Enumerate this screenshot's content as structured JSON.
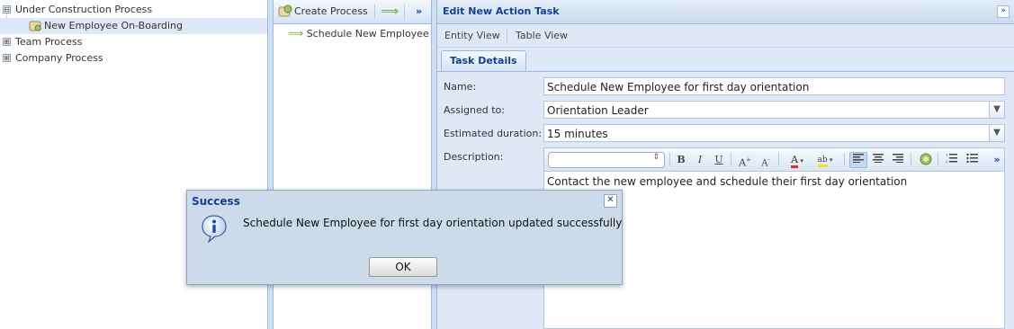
{
  "tree": {
    "items": [
      {
        "label": "Under Construction Process",
        "expander": "⊟"
      },
      {
        "label": "New Employee On-Boarding"
      },
      {
        "label": "Team Process",
        "expander": "⊞"
      },
      {
        "label": "Company Process",
        "expander": "⊞"
      }
    ]
  },
  "middle": {
    "create_label": "Create Process",
    "arrow_glyph": "⟹",
    "more_glyph": "»",
    "item_label": "Schedule New Employee fo"
  },
  "right": {
    "title": "Edit New Action Task",
    "collapse_glyph": "»",
    "views": [
      "Entity View",
      "Table View"
    ],
    "tab_label": "Task Details",
    "form": {
      "name_label": "Name:",
      "name_value": "Schedule New Employee for first day orientation",
      "assigned_label": "Assigned to:",
      "assigned_value": "Orientation Leader",
      "duration_label": "Estimated duration:",
      "duration_value": "15 minutes",
      "description_label": "Description:",
      "description_value": "Contact the new employee and schedule their first day orientation"
    }
  },
  "dialog": {
    "title": "Success",
    "close_glyph": "✕",
    "message": "Schedule New Employee for first day orientation updated successfully",
    "ok_label": "OK"
  },
  "colors": {
    "panel_bg": "#dfe8f6",
    "header_text": "#15428b",
    "border": "#99bbe8"
  }
}
